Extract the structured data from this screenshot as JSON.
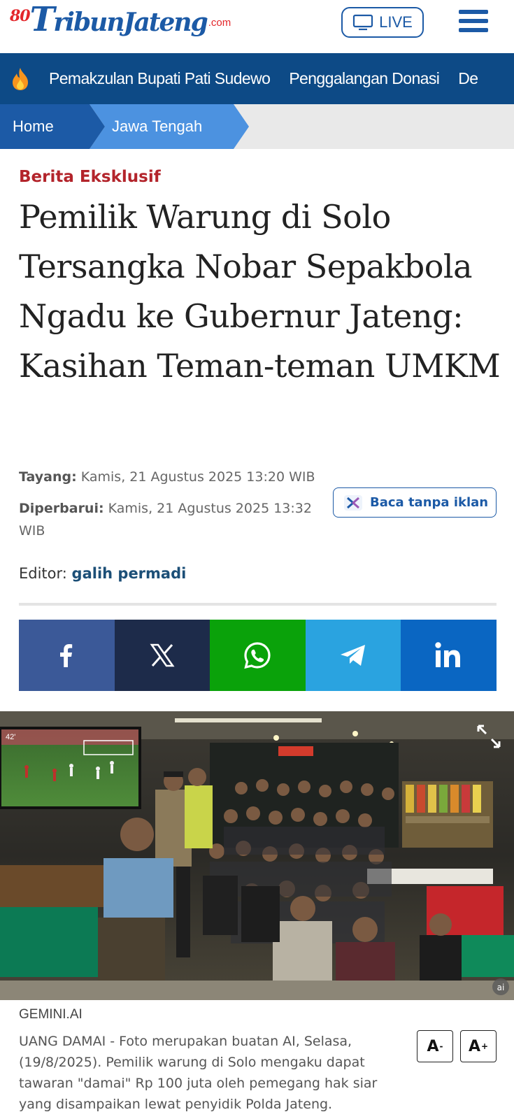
{
  "header": {
    "logo_badge": "80",
    "logo_brand_a": "T",
    "logo_brand_b": "ribunJateng",
    "logo_suffix": ".com",
    "live_label": "LIVE"
  },
  "trending": {
    "items": [
      "Pemakzulan Bupati Pati Sudewo",
      "Penggalangan Donasi",
      "De"
    ]
  },
  "breadcrumb": {
    "home": "Home",
    "section": "Jawa Tengah"
  },
  "article": {
    "kicker": "Berita Eksklusif",
    "headline": "Pemilik Warung di Solo Tersangka Nobar Sepakbola Ngadu ke Gubernur Jateng: Kasihan Teman-teman UMKM",
    "published_label": "Tayang:",
    "published_value": "Kamis, 21 Agustus 2025 13:20 WIB",
    "updated_label": "Diperbarui:",
    "updated_value": "Kamis, 21 Agustus 2025 13:32 WIB",
    "editor_label": "Editor:",
    "editor_name": "galih permadi",
    "adfree_label": "Baca tanpa iklan"
  },
  "share": {
    "buttons": [
      "facebook-icon",
      "x-icon",
      "whatsapp-icon",
      "telegram-icon",
      "linkedin-icon"
    ],
    "colors": [
      "#3b5998",
      "#1d2b4a",
      "#0aa20a",
      "#2aa3e0",
      "#0a66c2"
    ]
  },
  "photo": {
    "watermark": "ai",
    "tv_overlay": "42'",
    "credit": "GEMINI.AI",
    "caption": "UANG DAMAI - Foto merupakan buatan AI, Selasa, (19/8/2025). Pemilik warung di Solo mengaku dapat tawaran \"damai\" Rp 100 juta oleh pemegang hak siar yang disampaikan lewat penyidik Polda Jateng."
  },
  "font_controls": {
    "decrease_letter": "A",
    "decrease_mark": "-",
    "increase_letter": "A",
    "increase_mark": "+"
  }
}
